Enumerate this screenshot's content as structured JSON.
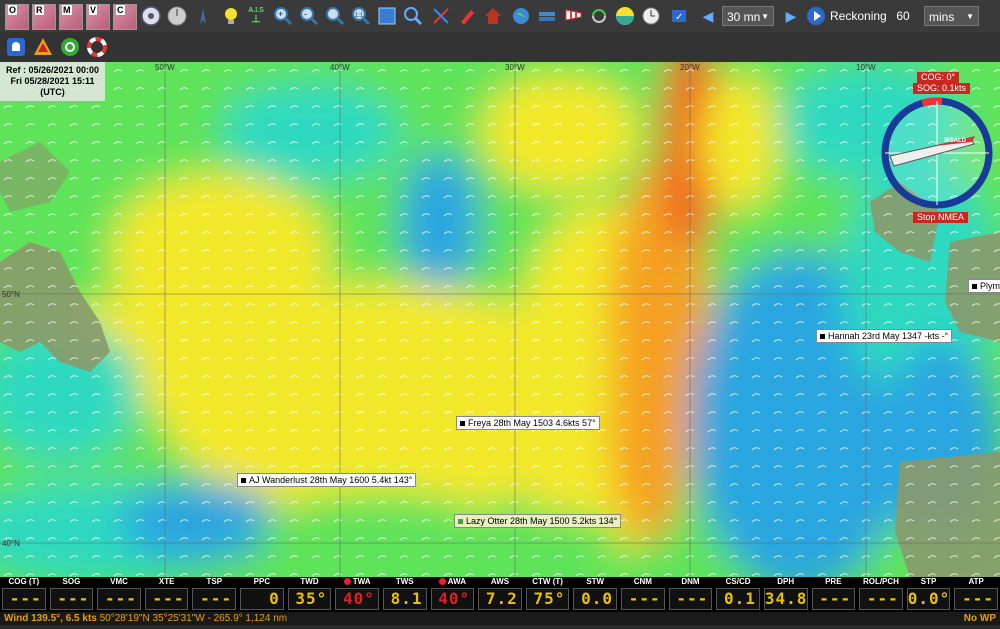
{
  "toolbar": {
    "chart_buttons": [
      "O",
      "R",
      "M",
      "V",
      "C"
    ],
    "ais_label": "A.I.S",
    "interval_select": "30 mn",
    "reckoning_label": "Reckoning",
    "reckoning_value": "60",
    "unit_select": "mins"
  },
  "map": {
    "ref_line1": "Ref : 05/26/2021 00:00",
    "ref_line2": "Fri 05/28/2021 15:11",
    "ref_line3": "(UTC)",
    "lon_labels": [
      "50°W",
      "40°W",
      "30°W",
      "20°W",
      "10°W"
    ],
    "lat_labels": [
      "50°N",
      "40°N"
    ],
    "boats": [
      {
        "label": "Hannah 23rd May 1347 -kts -°"
      },
      {
        "label": "Freya 28th May 1503 4.6kts 57°"
      },
      {
        "label": "AJ Wanderlust 28th May 1600 5.4kt 143°"
      },
      {
        "label": "Lazy Otter 28th May 1500 5.2kts 134°"
      }
    ],
    "place_label": "Plymo",
    "compass": {
      "cog": "COG: 0°",
      "sog": "SOG: 0.1kts",
      "stop_nmea": "Stop NMEA",
      "boat_name": "WSALD"
    }
  },
  "dashboard": [
    {
      "name": "COG (T)",
      "value": "----",
      "alert": false
    },
    {
      "name": "SOG",
      "value": "----",
      "alert": false
    },
    {
      "name": "VMC",
      "value": "----",
      "alert": false
    },
    {
      "name": "XTE",
      "value": "----",
      "alert": false
    },
    {
      "name": "TSP",
      "value": "---",
      "alert": false
    },
    {
      "name": "PPC",
      "value": "0",
      "alert": false
    },
    {
      "name": "TWD",
      "value": "35°",
      "alert": false
    },
    {
      "name": "TWA",
      "value": "40°",
      "alert": true
    },
    {
      "name": "TWS",
      "value": "8.1",
      "alert": false
    },
    {
      "name": "AWA",
      "value": "40°",
      "alert": true
    },
    {
      "name": "AWS",
      "value": "7.2",
      "alert": false
    },
    {
      "name": "CTW (T)",
      "value": "75°",
      "alert": false
    },
    {
      "name": "STW",
      "value": "0.0",
      "alert": false
    },
    {
      "name": "CNM",
      "value": "----",
      "alert": false
    },
    {
      "name": "DNM",
      "value": "----",
      "alert": false
    },
    {
      "name": "CS/CD",
      "value": "0.1",
      "alert": false
    },
    {
      "name": "DPH",
      "value": "34.8",
      "alert": false
    },
    {
      "name": "PRE",
      "value": "----",
      "alert": false
    },
    {
      "name": "ROL/PCH",
      "value": "----",
      "alert": false
    },
    {
      "name": "STP",
      "value": "0.0°",
      "alert": false
    },
    {
      "name": "ATP",
      "value": "----",
      "alert": false
    }
  ],
  "status": {
    "wind": "Wind 139.5°, 6.5 kts",
    "position": "50°28'19\"N 35°25'31\"W - 265.9° 1,124 nm",
    "nowp": "No WP"
  },
  "colors": {
    "sea_blue": "#2aa6e0",
    "sea_cyan": "#2fd9c0",
    "sea_green": "#5fe35a",
    "sea_yellow": "#f2e82a",
    "sea_orange": "#f5a020",
    "sea_red": "#f0601a",
    "land": "#8a9a6a"
  }
}
